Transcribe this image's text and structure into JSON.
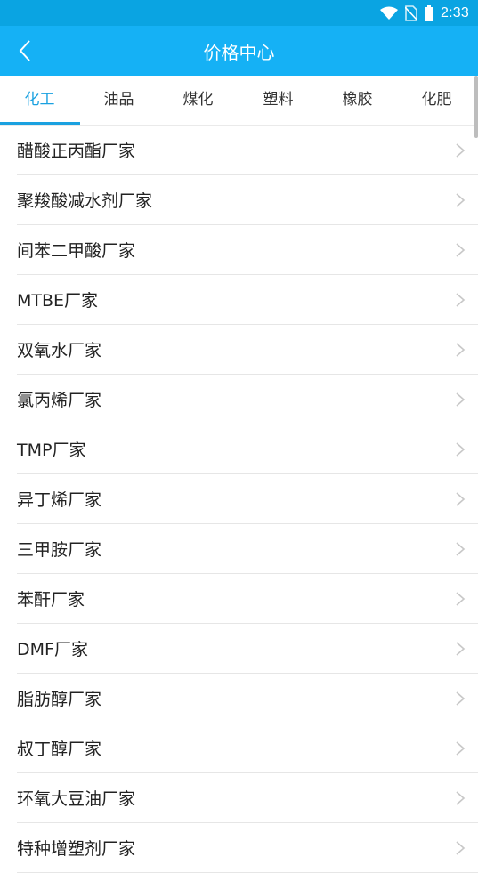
{
  "status_bar": {
    "time": "2:33"
  },
  "header": {
    "title": "价格中心"
  },
  "tabs": [
    {
      "label": "化工",
      "active": true
    },
    {
      "label": "油品",
      "active": false
    },
    {
      "label": "煤化",
      "active": false
    },
    {
      "label": "塑料",
      "active": false
    },
    {
      "label": "橡胶",
      "active": false
    },
    {
      "label": "化肥",
      "active": false
    }
  ],
  "list": {
    "items": [
      "醋酸正丙酯厂家",
      "聚羧酸减水剂厂家",
      "间苯二甲酸厂家",
      "MTBE厂家",
      "双氧水厂家",
      "氯丙烯厂家",
      "TMP厂家",
      "异丁烯厂家",
      "三甲胺厂家",
      "苯酐厂家",
      "DMF厂家",
      "脂肪醇厂家",
      "叔丁醇厂家",
      "环氧大豆油厂家",
      "特种增塑剂厂家"
    ]
  },
  "colors": {
    "status_bar": "#0aa4e2",
    "app_bar": "#15b1f5",
    "accent": "#1aa1e0"
  }
}
